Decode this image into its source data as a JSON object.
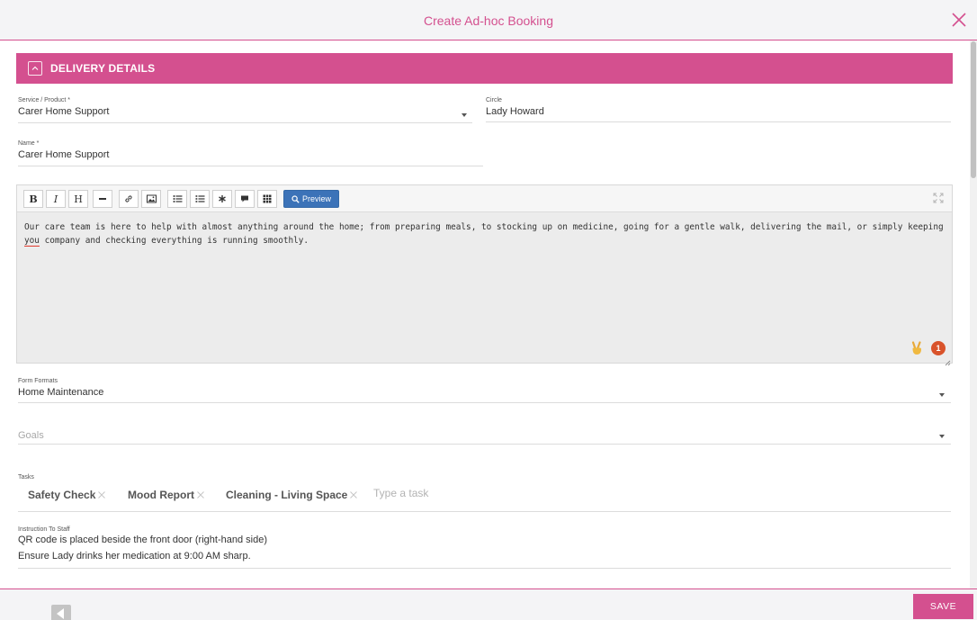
{
  "header": {
    "title": "Create Ad-hoc Booking"
  },
  "section": {
    "title": "DELIVERY DETAILS"
  },
  "service": {
    "label": "Service / Product *",
    "value": "Carer Home Support"
  },
  "circle": {
    "label": "Circle",
    "value": "Lady Howard"
  },
  "name": {
    "label": "Name *",
    "value": "Carer Home Support"
  },
  "editor": {
    "toolbar": {
      "bold": "B",
      "italic": "I",
      "heading": "H",
      "preview": "Preview"
    },
    "text_before": "Our care team is here to help with almost anything around the home; from preparing meals, to stocking up on medicine, going for a gentle walk, delivering the mail, or simply keeping ",
    "text_misspelled": "you",
    "text_after": " company and checking everything is running smoothly.",
    "badge_count": "1"
  },
  "form_formats": {
    "label": "Form Formats",
    "value": "Home Maintenance"
  },
  "goals": {
    "placeholder": "Goals"
  },
  "tasks": {
    "label": "Tasks",
    "items": [
      "Safety Check",
      "Mood Report",
      "Cleaning - Living Space"
    ],
    "input_placeholder": "Type a task"
  },
  "instruction": {
    "label": "Instruction To Staff",
    "line1": "QR code is placed beside the front door (right-hand side)",
    "line2": "Ensure Lady drinks her medication at 9:00 AM sharp."
  },
  "footer": {
    "save_label": "SAVE"
  },
  "colors": {
    "accent": "#d4508f",
    "preview_button": "#3c73b8",
    "badge": "#d9532b"
  }
}
